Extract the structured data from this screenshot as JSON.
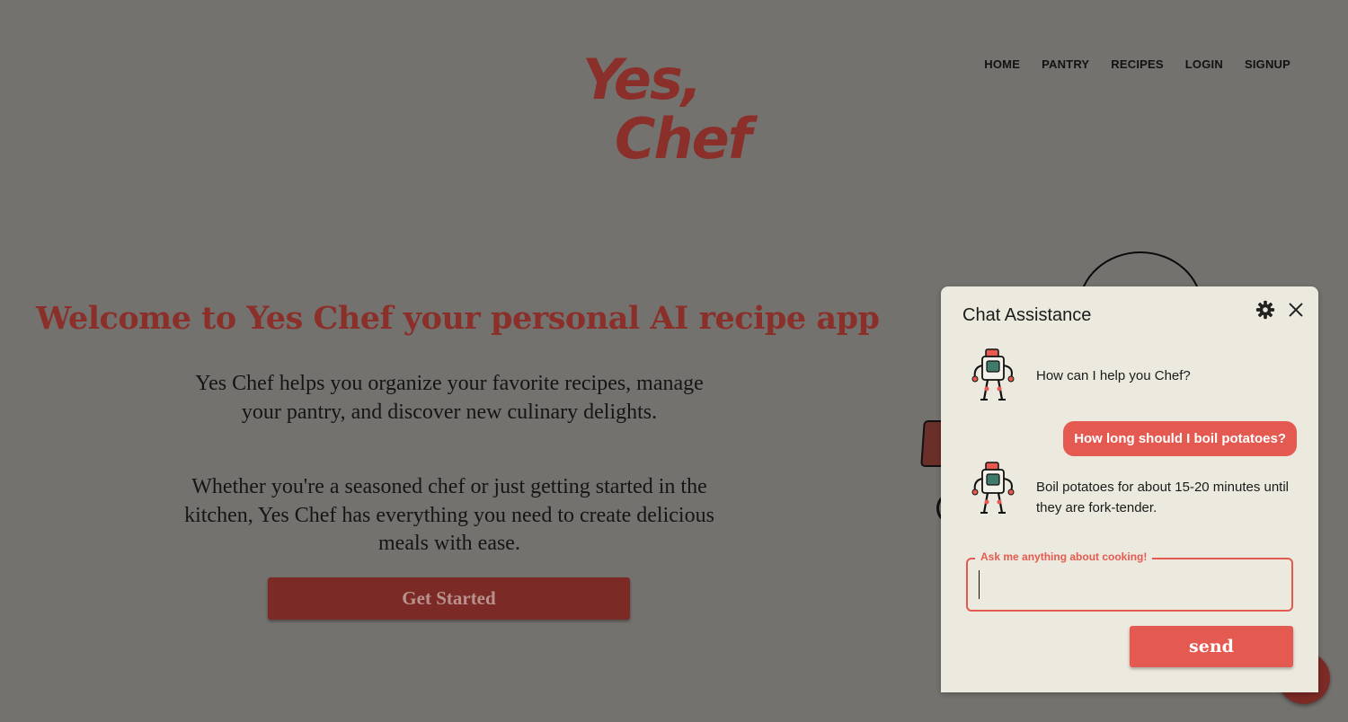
{
  "logo": {
    "line1": "Yes,",
    "line2": "Chef"
  },
  "nav": [
    "HOME",
    "PANTRY",
    "RECIPES",
    "LOGIN",
    "SIGNUP"
  ],
  "hero": {
    "title": "Welcome to Yes Chef your personal AI recipe app",
    "paragraph1": "Yes Chef helps you organize your favorite recipes, manage your pantry, and discover new culinary delights.",
    "paragraph2": "Whether you're a seasoned chef or just getting started in the kitchen, Yes Chef has everything you need to create delicious meals with ease.",
    "cta_label": "Get Started"
  },
  "chat": {
    "title": "Chat Assistance",
    "messages": [
      {
        "role": "bot",
        "text": "How can I help you Chef?"
      },
      {
        "role": "user",
        "text": "How long should I boil potatoes?"
      },
      {
        "role": "bot",
        "text": "Boil potatoes for about 15-20 minutes until they are fork-tender."
      }
    ],
    "input_label": "Ask me anything about cooking!",
    "input_value": "",
    "send_label": "send"
  },
  "icons": {
    "settings": "gear-icon",
    "close": "close-icon",
    "avatar": "robot-chef-avatar"
  },
  "colors": {
    "overlay_bg": "#74726e",
    "brand_red": "#8a2f2a",
    "accent": "#e55a50",
    "panel_bg": "#ece9de"
  }
}
